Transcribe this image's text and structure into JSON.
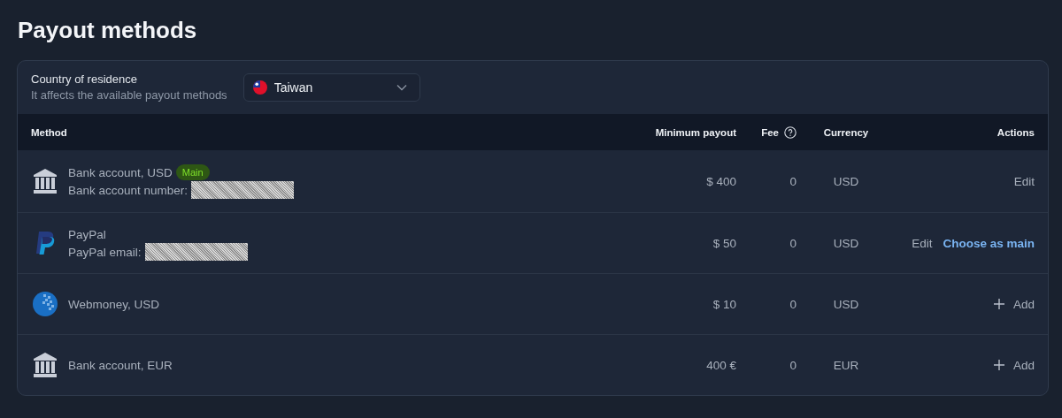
{
  "page": {
    "title": "Payout methods"
  },
  "residence": {
    "label": "Country of residence",
    "hint": "It affects the available payout methods",
    "country": "Taiwan"
  },
  "table": {
    "columns": [
      {
        "label": "Method"
      },
      {
        "label": "Minimum payout"
      },
      {
        "label": "Fee",
        "help": true
      },
      {
        "label": "Currency"
      },
      {
        "label": "Actions"
      }
    ],
    "rows": [
      {
        "kind": "bank",
        "name": "Bank account, USD",
        "badge": "Main",
        "detail": "Bank account number:",
        "redacted": true,
        "minimum": "$ 400",
        "fee": "0",
        "currency": "USD",
        "actions": [
          {
            "kind": "edit",
            "label": "Edit"
          }
        ]
      },
      {
        "kind": "paypal",
        "name": "PayPal",
        "detail": "PayPal email:",
        "redacted": true,
        "minimum": "$ 50",
        "fee": "0",
        "currency": "USD",
        "actions": [
          {
            "kind": "edit",
            "label": "Edit"
          },
          {
            "kind": "link",
            "label": "Choose as main"
          }
        ]
      },
      {
        "kind": "webmoney",
        "name": "Webmoney, USD",
        "minimum": "$ 10",
        "fee": "0",
        "currency": "USD",
        "actions": [
          {
            "kind": "add",
            "label": "Add"
          }
        ]
      },
      {
        "kind": "bank",
        "name": "Bank account, EUR",
        "minimum": "400 €",
        "fee": "0",
        "currency": "EUR",
        "actions": [
          {
            "kind": "add",
            "label": "Add"
          }
        ]
      }
    ]
  }
}
